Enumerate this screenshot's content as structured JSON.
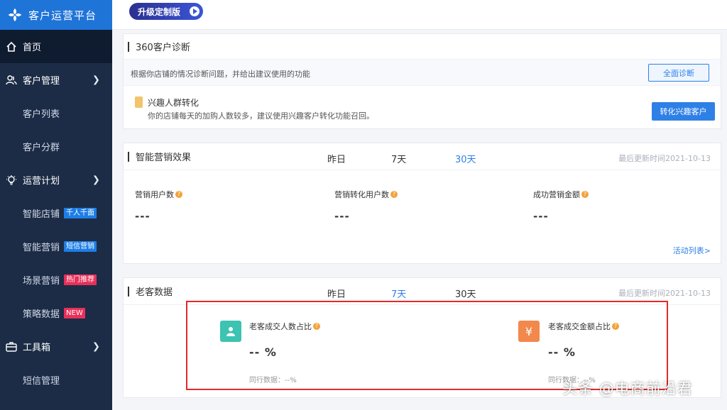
{
  "app": {
    "title": "客户运营平台",
    "upgrade_label": "升级定制版"
  },
  "sidebar": {
    "home": "首页",
    "customer_mgmt": "客户管理",
    "customer_list": "客户列表",
    "customer_group": "客户分群",
    "ops_plan": "运营计划",
    "smart_store": {
      "label": "智能店铺",
      "tag": "千人千面"
    },
    "smart_marketing": {
      "label": "智能营销",
      "tag": "短信营销"
    },
    "scene_marketing": {
      "label": "场景营销",
      "tag": "热门推荐"
    },
    "strategy_data": {
      "label": "策略数据",
      "tag": "NEW"
    },
    "toolbox": "工具箱",
    "sms_mgmt": "短信管理"
  },
  "diagnosis": {
    "title": "360客户诊断",
    "desc": "根据你店铺的情况诊断问题，并给出建议使用的功能",
    "full_btn": "全面诊断",
    "item_title": "兴趣人群转化",
    "item_desc": "你的店铺每天的加购人数较多，建议使用兴趣客户转化功能召回。",
    "item_btn": "转化兴趣客户"
  },
  "marketing": {
    "title": "智能营销效果",
    "ranges": [
      "昨日",
      "7天",
      "30天"
    ],
    "updated": "最后更新时间2021-10-13",
    "metrics": [
      {
        "label": "营销用户数",
        "value": "---"
      },
      {
        "label": "营销转化用户数",
        "value": "---"
      },
      {
        "label": "成功营销金额",
        "value": "---"
      }
    ],
    "link": "活动列表>"
  },
  "returning": {
    "title": "老客数据",
    "ranges": [
      "昨日",
      "7天",
      "30天"
    ],
    "updated": "最后更新时间2021-10-13",
    "left": {
      "label": "老客成交人数占比",
      "value": "-- %",
      "peer": "同行数据：--%"
    },
    "right": {
      "label": "老客成交金额占比",
      "value": "-- %",
      "peer": "同行数据：--%",
      "icon": "¥"
    }
  },
  "watermark": "头条 @电商前沿君",
  "colors": {
    "accent": "#2f80e6",
    "sidebar": "#1c2c46",
    "highlight": "#e22a2a"
  }
}
